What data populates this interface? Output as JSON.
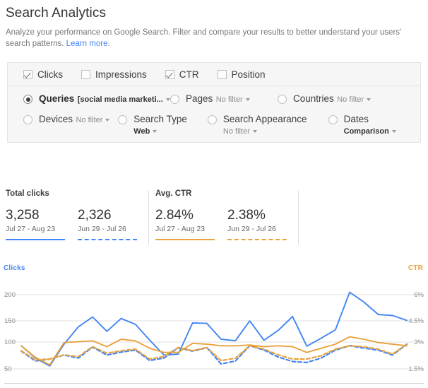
{
  "header": {
    "title": "Search Analytics",
    "description_part1": "Analyze your performance on Google Search. Filter and compare your results to better understand your users' search patterns. ",
    "learn_more": "Learn more",
    "description_end": "."
  },
  "metrics_row": {
    "items": [
      {
        "label": "Clicks",
        "checked": true
      },
      {
        "label": "Impressions",
        "checked": false
      },
      {
        "label": "CTR",
        "checked": true
      },
      {
        "label": "Position",
        "checked": false
      }
    ]
  },
  "dimensions": {
    "row1": [
      {
        "name": "Queries",
        "filter": "[social media marketi...",
        "selected": true
      },
      {
        "name": "Pages",
        "filter": "No filter",
        "selected": false
      },
      {
        "name": "Countries",
        "filter": "No filter",
        "selected": false
      }
    ],
    "row2": [
      {
        "name": "Devices",
        "filter": "No filter",
        "selected": false
      },
      {
        "name": "Search Type",
        "filter": "Web",
        "selected": false
      },
      {
        "name": "Search Appearance",
        "filter": "No filter",
        "selected": false
      },
      {
        "name": "Dates",
        "filter": "Comparison",
        "selected": false
      }
    ]
  },
  "summary": {
    "groups": [
      {
        "title": "Total clicks",
        "columns": [
          {
            "value": "3,258",
            "range": "Jul 27 - Aug 23",
            "style": "solid-blue"
          },
          {
            "value": "2,326",
            "range": "Jun 29 - Jul 26",
            "style": "dashed-blue"
          }
        ]
      },
      {
        "title": "Avg. CTR",
        "columns": [
          {
            "value": "2.84%",
            "range": "Jul 27 - Aug 23",
            "style": "solid-orange"
          },
          {
            "value": "2.38%",
            "range": "Jun 29 - Jul 26",
            "style": "dashed-orange"
          }
        ]
      }
    ]
  },
  "colors": {
    "clicks": "#4285f4",
    "ctr": "#e8a33d",
    "link": "#4285f4",
    "panel_bg": "#f6f6f6",
    "gridline": "#e2e2e2"
  },
  "chart_data": {
    "type": "line",
    "title": "",
    "xlabel": "",
    "grid": true,
    "left_axis": {
      "label": "Clicks",
      "color": "#4285f4",
      "ticks": [
        200,
        150,
        100,
        50
      ],
      "tick_labels": [
        "200",
        "150",
        "100",
        "50"
      ],
      "ylim": [
        0,
        233
      ]
    },
    "right_axis": {
      "label": "CTR",
      "color": "#e8a33d",
      "ticks": [
        6,
        4.5,
        3,
        1.5
      ],
      "tick_labels": [
        "6%",
        "4.5%",
        "3%",
        "1.5%"
      ],
      "ylim": [
        0,
        7
      ]
    },
    "x_count": 28,
    "series": [
      {
        "name": "Clicks Jul 27 - Aug 23",
        "axis": "left",
        "color": "#4285f4",
        "style": "solid",
        "values": [
          97,
          72,
          56,
          100,
          135,
          155,
          126,
          152,
          140,
          108,
          78,
          80,
          143,
          142,
          110,
          107,
          147,
          108,
          128,
          156,
          96,
          112,
          129,
          205,
          185,
          160,
          158,
          148
        ]
      },
      {
        "name": "Clicks Jun 29 - Jul 26",
        "axis": "left",
        "color": "#4285f4",
        "style": "dashed",
        "values": [
          86,
          66,
          70,
          78,
          72,
          94,
          78,
          84,
          88,
          67,
          72,
          93,
          86,
          93,
          60,
          66,
          97,
          88,
          74,
          65,
          63,
          72,
          88,
          97,
          92,
          88,
          78,
          100
        ]
      },
      {
        "name": "CTR Jul 27 - Aug 23",
        "axis": "right",
        "color": "#e8a33d",
        "style": "solid",
        "values": [
          2.9,
          2.2,
          1.75,
          3.1,
          3.15,
          3.2,
          2.85,
          3.3,
          3.2,
          2.75,
          2.5,
          2.5,
          3.05,
          3.0,
          2.9,
          2.9,
          2.95,
          2.85,
          2.9,
          2.85,
          2.5,
          2.75,
          3.0,
          3.45,
          3.3,
          3.1,
          3.0,
          2.9
        ]
      },
      {
        "name": "CTR Jun 29 - Jul 26",
        "axis": "right",
        "color": "#e8a33d",
        "style": "dashed",
        "values": [
          2.6,
          2.05,
          2.1,
          2.35,
          2.25,
          2.85,
          2.45,
          2.6,
          2.7,
          2.1,
          2.25,
          2.8,
          2.6,
          2.8,
          2.0,
          2.15,
          2.9,
          2.7,
          2.35,
          2.1,
          2.1,
          2.3,
          2.7,
          2.9,
          2.85,
          2.7,
          2.4,
          3.0
        ]
      }
    ]
  }
}
